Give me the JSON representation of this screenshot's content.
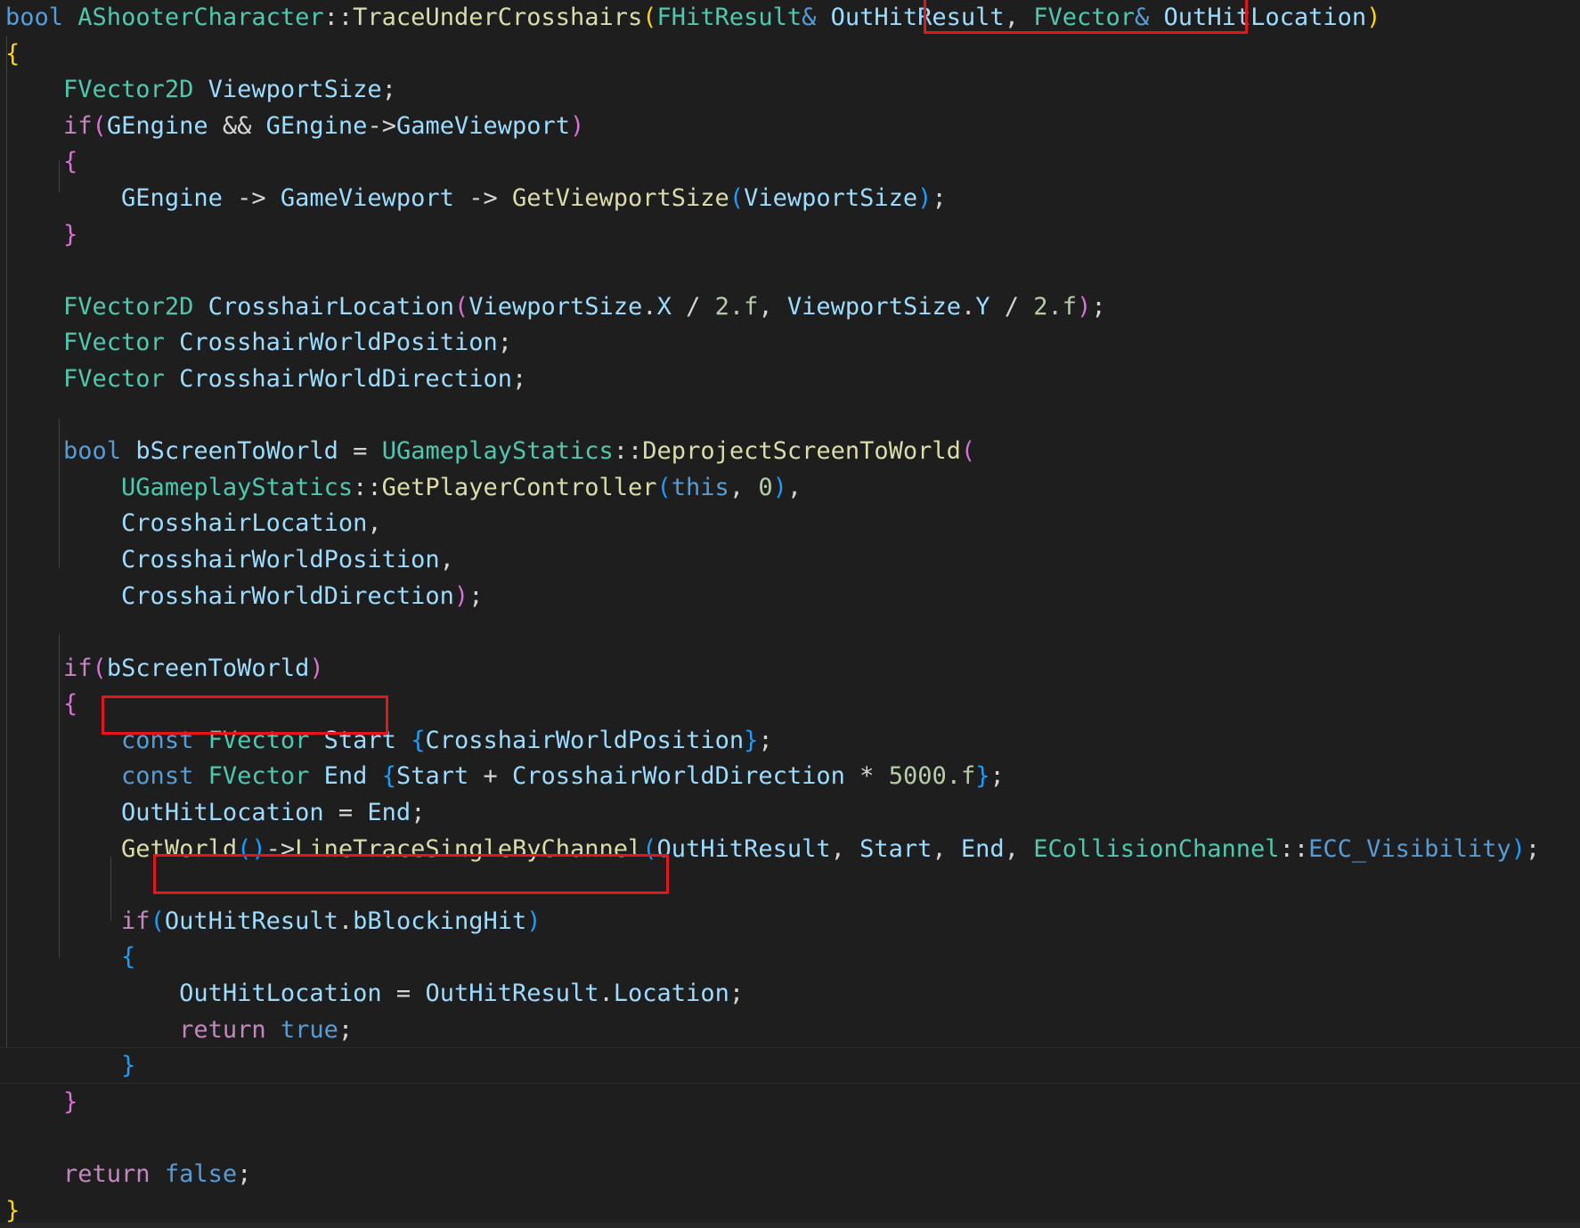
{
  "editor": {
    "language": "cpp",
    "theme_colors": {
      "background": "#1e1e1e",
      "keyword": "#569cd6",
      "control": "#c586c0",
      "type": "#4ec9b0",
      "function": "#dcdcaa",
      "variable": "#9cdcfe",
      "number": "#b5cea8",
      "plain": "#d4d4d4",
      "bracket_gold": "#ffd700",
      "bracket_pink": "#da70d6",
      "bracket_blue": "#179fff",
      "highlight_box": "#e8141b"
    },
    "highlighted_snippets": [
      "FVector& OutHitLocation)",
      "OutHitLocation = End;",
      "OutHitLocation = OutHitResult.Location;"
    ],
    "lines": [
      [
        [
          "kw",
          "bool"
        ],
        [
          "p",
          " "
        ],
        [
          "ty",
          "AShooterCharacter"
        ],
        [
          "p",
          "::"
        ],
        [
          "fn",
          "TraceUnderCrosshairs"
        ],
        [
          "bg",
          "("
        ],
        [
          "ty",
          "FHitResult"
        ],
        [
          "kw",
          "&"
        ],
        [
          "p",
          " "
        ],
        [
          "va",
          "OutHitResult"
        ],
        [
          "p",
          ", "
        ],
        [
          "ty",
          "FVector"
        ],
        [
          "kw",
          "&"
        ],
        [
          "p",
          " "
        ],
        [
          "va",
          "OutHitLocation"
        ],
        [
          "bg",
          ")"
        ]
      ],
      [
        [
          "bg",
          "{"
        ]
      ],
      [
        [
          "p",
          "    "
        ],
        [
          "ty",
          "FVector2D"
        ],
        [
          "p",
          " "
        ],
        [
          "va",
          "ViewportSize"
        ],
        [
          "p",
          ";"
        ]
      ],
      [
        [
          "p",
          "    "
        ],
        [
          "ct",
          "if"
        ],
        [
          "bp",
          "("
        ],
        [
          "va",
          "GEngine"
        ],
        [
          "p",
          " && "
        ],
        [
          "va",
          "GEngine"
        ],
        [
          "p",
          "->"
        ],
        [
          "va",
          "GameViewport"
        ],
        [
          "bp",
          ")"
        ]
      ],
      [
        [
          "p",
          "    "
        ],
        [
          "bp",
          "{"
        ]
      ],
      [
        [
          "p",
          "        "
        ],
        [
          "va",
          "GEngine"
        ],
        [
          "p",
          " -> "
        ],
        [
          "va",
          "GameViewport"
        ],
        [
          "p",
          " -> "
        ],
        [
          "fn",
          "GetViewportSize"
        ],
        [
          "bb",
          "("
        ],
        [
          "va",
          "ViewportSize"
        ],
        [
          "bb",
          ")"
        ],
        [
          "p",
          ";"
        ]
      ],
      [
        [
          "p",
          "    "
        ],
        [
          "bp",
          "}"
        ]
      ],
      [],
      [
        [
          "p",
          "    "
        ],
        [
          "ty",
          "FVector2D"
        ],
        [
          "p",
          " "
        ],
        [
          "va",
          "CrosshairLocation"
        ],
        [
          "bp",
          "("
        ],
        [
          "va",
          "ViewportSize"
        ],
        [
          "p",
          "."
        ],
        [
          "va",
          "X"
        ],
        [
          "p",
          " / "
        ],
        [
          "nu",
          "2.f"
        ],
        [
          "p",
          ", "
        ],
        [
          "va",
          "ViewportSize"
        ],
        [
          "p",
          "."
        ],
        [
          "va",
          "Y"
        ],
        [
          "p",
          " / "
        ],
        [
          "nu",
          "2.f"
        ],
        [
          "bp",
          ")"
        ],
        [
          "p",
          ";"
        ]
      ],
      [
        [
          "p",
          "    "
        ],
        [
          "ty",
          "FVector"
        ],
        [
          "p",
          " "
        ],
        [
          "va",
          "CrosshairWorldPosition"
        ],
        [
          "p",
          ";"
        ]
      ],
      [
        [
          "p",
          "    "
        ],
        [
          "ty",
          "FVector"
        ],
        [
          "p",
          " "
        ],
        [
          "va",
          "CrosshairWorldDirection"
        ],
        [
          "p",
          ";"
        ]
      ],
      [],
      [
        [
          "p",
          "    "
        ],
        [
          "kw",
          "bool"
        ],
        [
          "p",
          " "
        ],
        [
          "va",
          "bScreenToWorld"
        ],
        [
          "p",
          " = "
        ],
        [
          "ty",
          "UGameplayStatics"
        ],
        [
          "p",
          "::"
        ],
        [
          "fn",
          "DeprojectScreenToWorld"
        ],
        [
          "bp",
          "("
        ]
      ],
      [
        [
          "p",
          "        "
        ],
        [
          "ty",
          "UGameplayStatics"
        ],
        [
          "p",
          "::"
        ],
        [
          "fn",
          "GetPlayerController"
        ],
        [
          "bb",
          "("
        ],
        [
          "kw",
          "this"
        ],
        [
          "p",
          ", "
        ],
        [
          "nu",
          "0"
        ],
        [
          "bb",
          ")"
        ],
        [
          "p",
          ","
        ]
      ],
      [
        [
          "p",
          "        "
        ],
        [
          "va",
          "CrosshairLocation"
        ],
        [
          "p",
          ","
        ]
      ],
      [
        [
          "p",
          "        "
        ],
        [
          "va",
          "CrosshairWorldPosition"
        ],
        [
          "p",
          ","
        ]
      ],
      [
        [
          "p",
          "        "
        ],
        [
          "va",
          "CrosshairWorldDirection"
        ],
        [
          "bp",
          ")"
        ],
        [
          "p",
          ";"
        ]
      ],
      [],
      [
        [
          "p",
          "    "
        ],
        [
          "ct",
          "if"
        ],
        [
          "bp",
          "("
        ],
        [
          "va",
          "bScreenToWorld"
        ],
        [
          "bp",
          ")"
        ]
      ],
      [
        [
          "p",
          "    "
        ],
        [
          "bp",
          "{"
        ]
      ],
      [
        [
          "p",
          "        "
        ],
        [
          "kw",
          "const"
        ],
        [
          "p",
          " "
        ],
        [
          "ty",
          "FVector"
        ],
        [
          "p",
          " "
        ],
        [
          "va",
          "Start"
        ],
        [
          "p",
          " "
        ],
        [
          "bb",
          "{"
        ],
        [
          "va",
          "CrosshairWorldPosition"
        ],
        [
          "bb",
          "}"
        ],
        [
          "p",
          ";"
        ]
      ],
      [
        [
          "p",
          "        "
        ],
        [
          "kw",
          "const"
        ],
        [
          "p",
          " "
        ],
        [
          "ty",
          "FVector"
        ],
        [
          "p",
          " "
        ],
        [
          "va",
          "End"
        ],
        [
          "p",
          " "
        ],
        [
          "bb",
          "{"
        ],
        [
          "va",
          "Start"
        ],
        [
          "p",
          " + "
        ],
        [
          "va",
          "CrosshairWorldDirection"
        ],
        [
          "p",
          " * "
        ],
        [
          "nu",
          "5000.f"
        ],
        [
          "bb",
          "}"
        ],
        [
          "p",
          ";"
        ]
      ],
      [
        [
          "p",
          "        "
        ],
        [
          "va",
          "OutHitLocation"
        ],
        [
          "p",
          " = "
        ],
        [
          "va",
          "End"
        ],
        [
          "p",
          ";"
        ]
      ],
      [
        [
          "p",
          "        "
        ],
        [
          "fn",
          "GetWorld"
        ],
        [
          "bb",
          "()"
        ],
        [
          "p",
          "->"
        ],
        [
          "fn",
          "LineTraceSingleByChannel"
        ],
        [
          "bb",
          "("
        ],
        [
          "va",
          "OutHitResult"
        ],
        [
          "p",
          ", "
        ],
        [
          "va",
          "Start"
        ],
        [
          "p",
          ", "
        ],
        [
          "va",
          "End"
        ],
        [
          "p",
          ", "
        ],
        [
          "ty",
          "ECollisionChannel"
        ],
        [
          "p",
          "::"
        ],
        [
          "kw",
          "ECC_Visibility"
        ],
        [
          "bb",
          ")"
        ],
        [
          "p",
          ";"
        ]
      ],
      [],
      [
        [
          "p",
          "        "
        ],
        [
          "ct",
          "if"
        ],
        [
          "bb",
          "("
        ],
        [
          "va",
          "OutHitResult"
        ],
        [
          "p",
          "."
        ],
        [
          "va",
          "bBlockingHit"
        ],
        [
          "bb",
          ")"
        ]
      ],
      [
        [
          "p",
          "        "
        ],
        [
          "bb",
          "{"
        ]
      ],
      [
        [
          "p",
          "            "
        ],
        [
          "va",
          "OutHitLocation"
        ],
        [
          "p",
          " = "
        ],
        [
          "va",
          "OutHitResult"
        ],
        [
          "p",
          "."
        ],
        [
          "va",
          "Location"
        ],
        [
          "p",
          ";"
        ]
      ],
      [
        [
          "p",
          "            "
        ],
        [
          "ct",
          "return"
        ],
        [
          "p",
          " "
        ],
        [
          "kw",
          "true"
        ],
        [
          "p",
          ";"
        ]
      ],
      [
        [
          "p",
          "        "
        ],
        [
          "bb",
          "}"
        ]
      ],
      [
        [
          "p",
          "    "
        ],
        [
          "bp",
          "}"
        ]
      ],
      [],
      [
        [
          "p",
          "    "
        ],
        [
          "ct",
          "return"
        ],
        [
          "p",
          " "
        ],
        [
          "kw",
          "false"
        ],
        [
          "p",
          ";"
        ]
      ],
      [
        [
          "bg",
          "}"
        ]
      ]
    ]
  }
}
